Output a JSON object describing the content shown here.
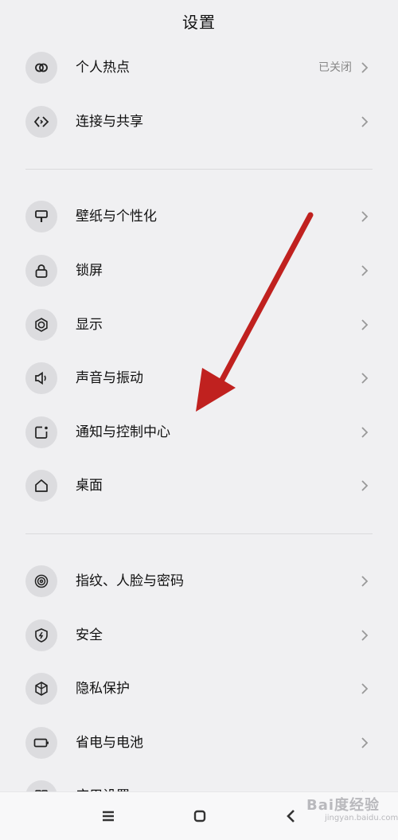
{
  "header": {
    "title": "设置"
  },
  "items": [
    {
      "label": "个人热点",
      "value": "已关闭",
      "icon": "hotspot-icon"
    },
    {
      "label": "连接与共享",
      "icon": "share-icon"
    },
    {
      "label": "壁纸与个性化",
      "icon": "brush-icon"
    },
    {
      "label": "锁屏",
      "icon": "lock-icon"
    },
    {
      "label": "显示",
      "icon": "brightness-icon"
    },
    {
      "label": "声音与振动",
      "icon": "speaker-icon"
    },
    {
      "label": "通知与控制中心",
      "icon": "notification-icon"
    },
    {
      "label": "桌面",
      "icon": "home-icon"
    },
    {
      "label": "指纹、人脸与密码",
      "icon": "fingerprint-icon"
    },
    {
      "label": "安全",
      "icon": "shield-icon"
    },
    {
      "label": "隐私保护",
      "icon": "privacy-icon"
    },
    {
      "label": "省电与电池",
      "icon": "battery-icon"
    },
    {
      "label": "应用设置",
      "icon": "apps-icon"
    }
  ],
  "watermark": {
    "text": "Bai度经验",
    "sub": "jingyan.baidu.com"
  },
  "colors": {
    "background": "#f0f0f2",
    "icon_circle": "#dcdcdf",
    "arrow": "#c0211f"
  }
}
